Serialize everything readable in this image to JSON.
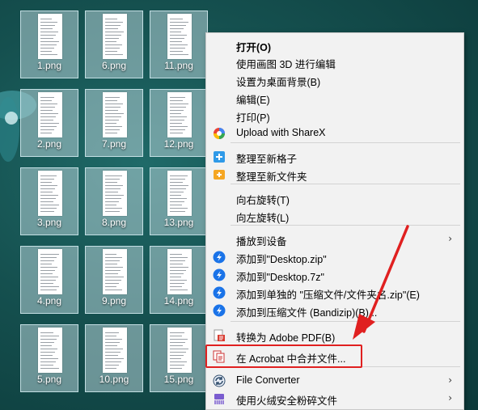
{
  "desktop": {
    "files": [
      {
        "name": "1.png"
      },
      {
        "name": "6.png"
      },
      {
        "name": "11.png"
      },
      {
        "name": "2.png"
      },
      {
        "name": "7.png"
      },
      {
        "name": "12.png"
      },
      {
        "name": "3.png"
      },
      {
        "name": "8.png"
      },
      {
        "name": "13.png"
      },
      {
        "name": "4.png"
      },
      {
        "name": "9.png"
      },
      {
        "name": "14.png"
      },
      {
        "name": "5.png"
      },
      {
        "name": "10.png"
      },
      {
        "name": "15.png"
      }
    ]
  },
  "context_menu": {
    "items": [
      {
        "label": "打开(O)",
        "bold": true,
        "icon": ""
      },
      {
        "label": "使用画图 3D 进行编辑",
        "icon": ""
      },
      {
        "label": "设置为桌面背景(B)",
        "icon": ""
      },
      {
        "label": "编辑(E)",
        "icon": ""
      },
      {
        "label": "打印(P)",
        "icon": ""
      },
      {
        "label": "Upload with ShareX",
        "icon": "sharex-icon"
      },
      {
        "label": "整理至新格子",
        "icon": "new-grid-icon"
      },
      {
        "label": "整理至新文件夹",
        "icon": "new-folder-icon"
      },
      {
        "label": "向右旋转(T)",
        "icon": ""
      },
      {
        "label": "向左旋转(L)",
        "icon": ""
      },
      {
        "label": "播放到设备",
        "icon": "",
        "submenu": true
      },
      {
        "label": "添加到\"Desktop.zip\"",
        "icon": "bandizip-icon"
      },
      {
        "label": "添加到\"Desktop.7z\"",
        "icon": "bandizip-icon"
      },
      {
        "label": "添加到单独的 \"压缩文件/文件夹名.zip\"(E)",
        "icon": "bandizip-icon"
      },
      {
        "label": "添加到压缩文件 (Bandizip)(B)...",
        "icon": "bandizip-icon"
      },
      {
        "label": "转换为 Adobe PDF(B)",
        "icon": "acrobat-icon"
      },
      {
        "label": "在 Acrobat 中合并文件...",
        "icon": "acrobat-combine-icon"
      },
      {
        "label": "File Converter",
        "icon": "file-converter-icon",
        "submenu": true
      },
      {
        "label": "使用火绒安全粉碎文件",
        "icon": "huorong-shred-icon",
        "submenu": true
      }
    ],
    "submenu_arrow": "›"
  },
  "annotation": {
    "color": "#e02020"
  }
}
